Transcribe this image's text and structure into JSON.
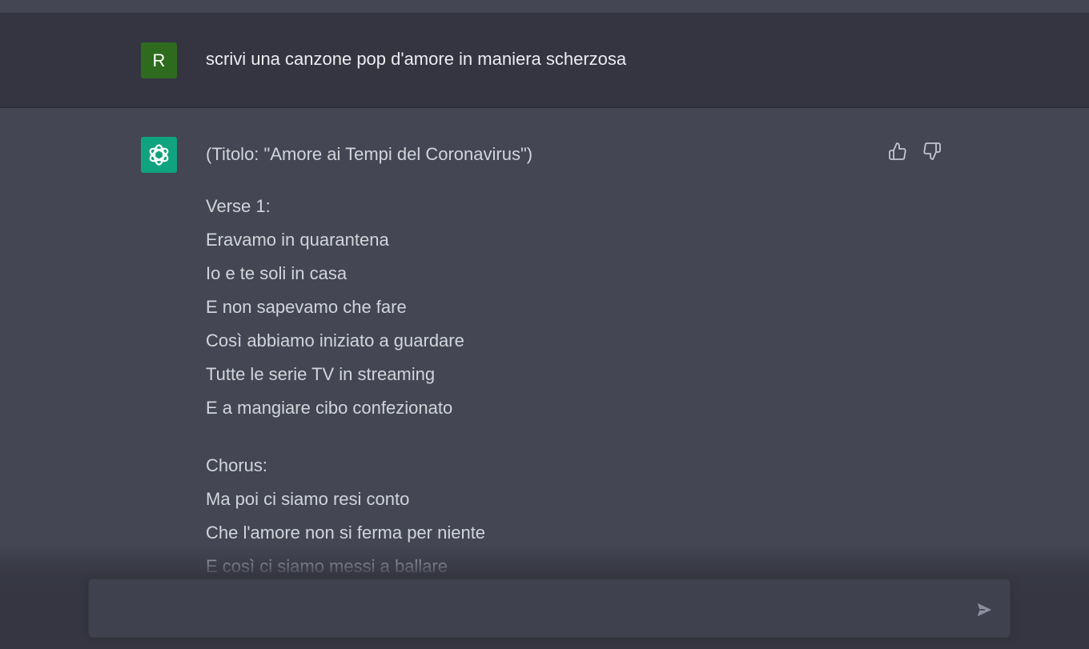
{
  "user_message": {
    "avatar_initial": "R",
    "avatar_color": "#2e6b1f",
    "text": "scrivi una canzone pop d'amore in maniera scherzosa"
  },
  "assistant_message": {
    "avatar_icon": "openai-logo-icon",
    "avatar_color": "#10a37f",
    "title_line": "(Titolo: \"Amore ai Tempi del Coronavirus\")",
    "verse_1": {
      "label": "Verse 1:",
      "lines": [
        "Eravamo in quarantena",
        "Io e te soli in casa",
        "E non sapevamo che fare",
        "Così abbiamo iniziato a guardare",
        "Tutte le serie TV in streaming",
        "E a mangiare cibo confezionato"
      ]
    },
    "chorus": {
      "label": "Chorus:",
      "lines": [
        "Ma poi ci siamo resi conto",
        "Che l'amore non si ferma per niente",
        "E così ci siamo messi a ballare"
      ]
    },
    "feedback": {
      "thumbs_up_icon": "thumbs-up-icon",
      "thumbs_down_icon": "thumbs-down-icon"
    }
  },
  "composer": {
    "placeholder": "",
    "send_icon": "send-icon"
  },
  "colors": {
    "user_row_bg": "#343541",
    "assistant_row_bg": "#444654",
    "text_primary": "#ececf1",
    "text_answer": "#d1d5db",
    "composer_bg": "#40414f"
  }
}
